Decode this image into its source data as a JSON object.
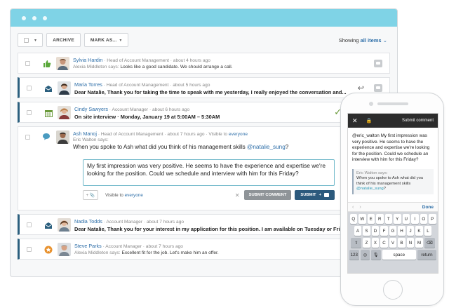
{
  "toolbar": {
    "archive_label": "ARCHIVE",
    "mark_label": "MARK AS...",
    "showing_prefix": "Showing",
    "showing_value": "all items"
  },
  "items": [
    {
      "name": "Sylvia Hardin",
      "meta": "· Head of Account Management · about 4 hours ago",
      "line2_who": "Alexia Middleton",
      "line2_says": "says:",
      "line2_text": "Looks like a good candidate. We should arrange a call.",
      "icon": "thumbs-up-icon",
      "color": "#5aa83a"
    },
    {
      "name": "Maria Torres",
      "meta": "· Head of Account Management · about 5 hours ago",
      "line2_text": "Dear Natalie, Thank you for taking the time to speak with me yesterday, I really enjoyed the conversation and...",
      "icon": "envelope-icon",
      "color": "#2b5f7e"
    },
    {
      "name": "Cindy Sawyers",
      "meta": "· Account Manager · about 6 hours ago",
      "line2_text": "On site interview · Monday, January 19 at 5:00AM – 5:30AM",
      "icon": "calendar-icon",
      "color": "#6a9a3a"
    },
    {
      "name": "Nadia Todds",
      "meta": "· Account Manager · about 7 hours ago",
      "line2_text": "Dear Natalie, Thank you for your interest in my application for this position. I am available on Tuesday or Fri...",
      "icon": "envelope-icon",
      "color": "#2b5f7e"
    },
    {
      "name": "Steve Parks",
      "meta": "· Account Manager · about 7 hours ago",
      "line2_who": "Alexia Middleton",
      "line2_says": "says:",
      "line2_text": "Excellent fit for the job. Let's make him an offer.",
      "icon": "star-badge-icon",
      "color": "#e8912d"
    }
  ],
  "expanded": {
    "name": "Ash Manoj",
    "meta": "· Head of Account Management · about 7 hours ago · Visible to",
    "visible_to": "everyone",
    "says": "Eric Walton says:",
    "question": "When you spoke to Ash what did you think of his management skills",
    "mention": "@natalie_sung",
    "question_end": "?",
    "reply_text": "My first impression was very positive. He seems to have the experience and expertise we're looking for the position. Could we schedule and interview with him for this Friday?",
    "visible_label": "Visible to",
    "visible_value": "everyone",
    "submit_comment": "SUBMIT COMMENT",
    "submit": "SUBMIT"
  },
  "phone": {
    "header_action": "Submit comment",
    "message": "@eric_walton My first impression was very positive. He seems to have the experience and expertise we're looking for the position. Could we schedule an interview with him for this Friday?",
    "quote_who": "Eric Walton says:",
    "quote_text": "When you spoke to Ash what did you think of his management skills",
    "quote_mention": "@natalie_sung",
    "quote_end": "?",
    "done": "Done",
    "keys_row1": [
      "Q",
      "W",
      "E",
      "R",
      "T",
      "Y",
      "U",
      "I",
      "O",
      "P"
    ],
    "keys_row2": [
      "A",
      "S",
      "D",
      "F",
      "G",
      "H",
      "J",
      "K",
      "L"
    ],
    "keys_row3": [
      "Z",
      "X",
      "C",
      "V",
      "B",
      "N",
      "M"
    ],
    "key_num": "123",
    "key_space": "space",
    "key_return": "return"
  }
}
